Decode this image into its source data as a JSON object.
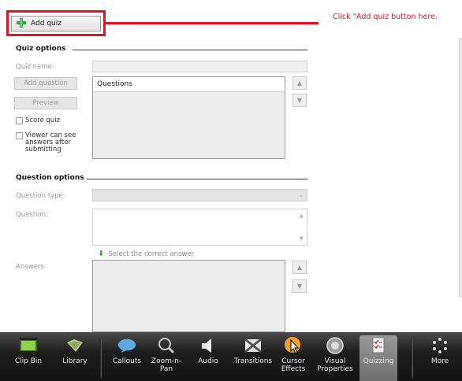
{
  "add_quiz": {
    "label": "Add quiz"
  },
  "callout": {
    "text": "Click \"Add quiz button here."
  },
  "quiz_options": {
    "title": "Quiz options",
    "quiz_name_label": "Quiz name:",
    "quiz_name_value": "",
    "add_question_label": "Add question",
    "preview_label": "Preview",
    "score_quiz_label": "Score quiz",
    "viewer_label": "Viewer can see answers after submitting",
    "questions_header": "Questions"
  },
  "question_options": {
    "title": "Question options",
    "type_label": "Question type:",
    "question_label": "Question:",
    "hint": "Select the correct answer",
    "answers_label": "Answers:"
  },
  "toolbar": {
    "items": [
      {
        "label": "Clip Bin"
      },
      {
        "label": "Library"
      },
      {
        "label": "Callouts"
      },
      {
        "label": "Zoom-n-Pan"
      },
      {
        "label": "Audio"
      },
      {
        "label": "Transitions"
      },
      {
        "label": "Cursor Effects"
      },
      {
        "label": "Visual Properties"
      },
      {
        "label": "Quizzing"
      },
      {
        "label": "More"
      }
    ]
  }
}
